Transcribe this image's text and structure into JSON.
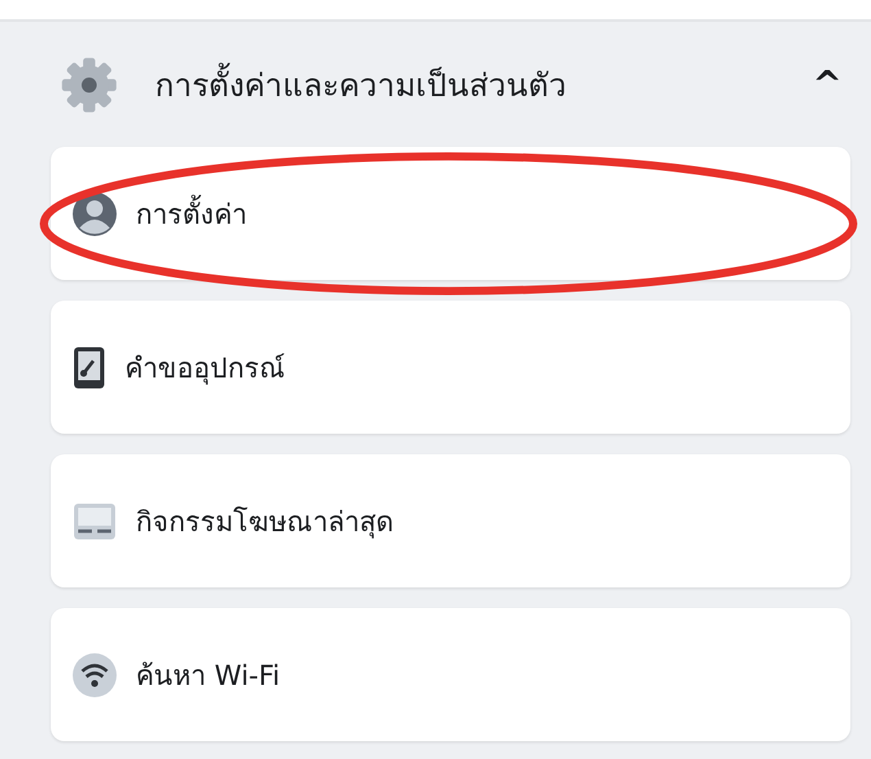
{
  "section": {
    "title": "การตั้งค่าและความเป็นส่วนตัว",
    "expanded": true,
    "chevron": "^"
  },
  "items": [
    {
      "label": "การตั้งค่า",
      "kind": "account",
      "highlighted": true
    },
    {
      "label": "คำขออุปกรณ์",
      "kind": "device",
      "highlighted": false
    },
    {
      "label": "กิจกรรมโฆษณาล่าสุด",
      "kind": "ads",
      "highlighted": false
    },
    {
      "label": "ค้นหา Wi-Fi",
      "kind": "wifi",
      "highlighted": false
    }
  ]
}
